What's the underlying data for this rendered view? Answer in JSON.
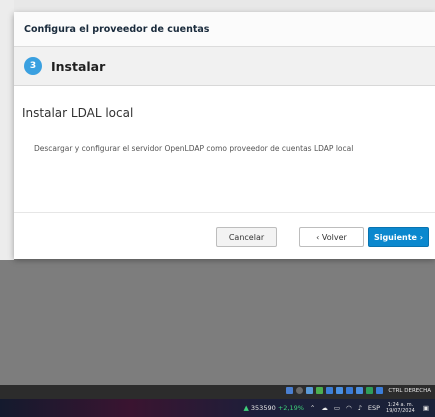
{
  "dialog": {
    "title": "Configura el proveedor de cuentas",
    "step": {
      "number": "3",
      "title": "Instalar"
    },
    "body": {
      "heading": "Instalar LDAL local",
      "description": "Descargar y configurar el servidor OpenLDAP como proveedor de cuentas LDAP local"
    },
    "footer": {
      "cancel_label": "Cancelar",
      "back_label": "‹ Volver",
      "next_label": "Siguiente ›"
    }
  },
  "taskbar": {
    "tray_label": "CTRL DERECHA",
    "stock_value": "353590",
    "stock_change": "+2,19%",
    "language": "ESP",
    "time": "1:24 a. m.",
    "date": "19/07/2024"
  },
  "colors": {
    "accent": "#0b88ce",
    "step_badge": "#3aa0e0",
    "backdrop": "#7d7d7d",
    "stock_positive": "#3fd07a"
  }
}
